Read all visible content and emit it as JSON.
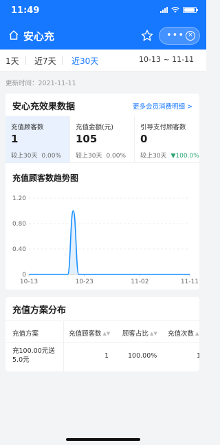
{
  "status_bar": {
    "time": "11:49"
  },
  "header": {
    "title": "安心充",
    "more_dots": "•••",
    "close_glyph": "×"
  },
  "tabs": [
    {
      "label": "1天",
      "active": false
    },
    {
      "label": "近7天",
      "active": false
    },
    {
      "label": "近30天",
      "active": true
    }
  ],
  "date_range": "10-13 ~ 11-11",
  "updated_at": "更新时间：2021-11-11",
  "effect": {
    "title": "安心充效果数据",
    "more_link": "更多会员消费明细 >",
    "metrics": [
      {
        "label": "充值顾客数",
        "value": "1",
        "compare_label": "较上30天",
        "compare_pct": "0.00%"
      },
      {
        "label": "充值金额(元)",
        "value": "105",
        "compare_label": "较上30天",
        "compare_pct": "0.00%"
      },
      {
        "label": "引导支付顾客数",
        "value": "0",
        "compare_label": "较上30天",
        "compare_pct": "▼100.0%"
      }
    ]
  },
  "chart_title": "充值顾客数趋势图",
  "chart_data": {
    "type": "line",
    "x": [
      "10-13",
      "10-14",
      "10-15",
      "10-16",
      "10-17",
      "10-18",
      "10-19",
      "10-20",
      "10-21",
      "10-22",
      "10-23",
      "10-24",
      "10-25",
      "10-26",
      "10-27",
      "10-28",
      "10-29",
      "10-30",
      "10-31",
      "11-01",
      "11-02",
      "11-03",
      "11-04",
      "11-05",
      "11-06",
      "11-07",
      "11-08",
      "11-09",
      "11-10",
      "11-11"
    ],
    "values": [
      0,
      0,
      0,
      0,
      0,
      0,
      0,
      0,
      1,
      0,
      0,
      0,
      0,
      0,
      0,
      0,
      0,
      0,
      0,
      0,
      0,
      0,
      0,
      0,
      0,
      0,
      0,
      0,
      0,
      0
    ],
    "xticks": [
      "10-13",
      "10-23",
      "11-02",
      "11-11"
    ],
    "yticks": [
      "0",
      "0.40",
      "0.80",
      "1.20"
    ],
    "ylim": [
      0,
      1.2
    ],
    "line_color": "#1890ff",
    "fill_color": "#cfe5fb"
  },
  "plan": {
    "title": "充值方案分布",
    "columns": [
      "充值方案",
      "充值顾客数",
      "顾客占比",
      "充值次数"
    ],
    "rows": [
      {
        "name": "充100.00元送5.0元",
        "customers": "1",
        "ratio": "100.00%",
        "times": "1"
      }
    ]
  }
}
